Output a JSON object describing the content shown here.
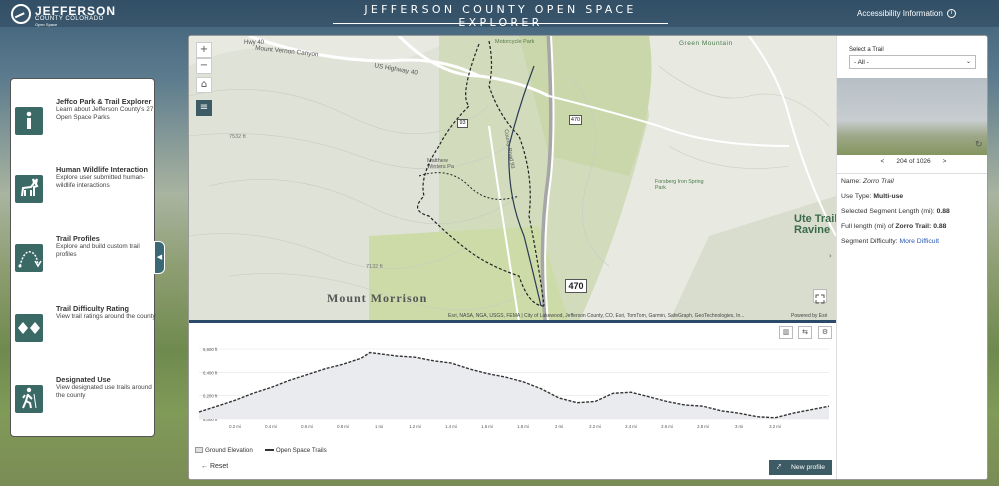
{
  "header": {
    "logo_line1": "JEFFERSON",
    "logo_line2": "COUNTY COLORADO",
    "logo_line3": "Open Space",
    "title": "JEFFERSON COUNTY OPEN SPACE EXPLORER",
    "accessibility": "Accessibility Information",
    "help_icon": "question-circle-icon"
  },
  "sidebar": {
    "items": [
      {
        "title": "Jeffco Park & Trail Explorer",
        "desc": "Learn about Jefferson County's 27 Open Space Parks",
        "icon": "info-icon"
      },
      {
        "title": "Human Wildlife Interaction",
        "desc": "Explore user submitted human-wildlife interactions",
        "icon": "deer-icon"
      },
      {
        "title": "Trail Profiles",
        "desc": "Explore and build custom trail profiles",
        "icon": "trail-profile-icon"
      },
      {
        "title": "Trail Difficulty Rating",
        "desc": "View trail ratings around the county",
        "icon": "diamond-icon"
      },
      {
        "title": "Designated Use",
        "desc": "View designated use trails around the county",
        "icon": "hiker-icon"
      }
    ]
  },
  "map": {
    "labels": {
      "mount_vernon": "Mount Vernon Canyon",
      "us_highway": "US Highway 40",
      "hwy_40": "Hwy 40",
      "motorcycle": "Motorcycle Park",
      "green_mountain": "Green Mountain",
      "county_road": "County Road 93",
      "matthews": "Matthew Winters Pa",
      "forsberg": "Forsberg Iron Spring Park",
      "ute_trail": "Ute Trail Ravine",
      "mount_morrison": "Mount Morrison",
      "elev1": "7532 ft",
      "elev2": "7132 ft",
      "shield_93": "93",
      "shield_470": "470",
      "shield_470b": "470"
    },
    "attribution": "Esri, NASA, NGA, USGS, FEMA | City of Lakewood, Jefferson County, CO, Esri, TomTom, Garmin, SafeGraph, GeoTechnologies, In...",
    "powered": "Powered by Esri"
  },
  "trail_panel": {
    "select_label": "Select a Trail",
    "select_value": "- All -",
    "pager_text": "204 of 1026",
    "prev": "<",
    "next": ">",
    "name_label": "Name:",
    "name_value": "Zorro Trail",
    "use_label": "Use Type:",
    "use_value": "Multi-use",
    "seg_label": "Selected Segment Length (mi):",
    "seg_value": "0.88",
    "full_label": "Full length (mi) of",
    "full_trail": "Zorro Trail:",
    "full_value": "0.88",
    "diff_label": "Segment Difficulty:",
    "diff_value": "More Difficult"
  },
  "profile": {
    "legend_ground": "Ground Elevation",
    "legend_trails": "Open Space Trails",
    "reset": "Reset",
    "new_profile": "New profile"
  },
  "colors": {
    "accent": "#3d5b64",
    "sidebar_icon": "#3b6a66",
    "link": "#2a5bb5"
  },
  "chart_data": {
    "type": "area",
    "xlabel": "",
    "ylabel": "",
    "x_ticks": [
      "0.2 mi",
      "0.4 mi",
      "0.6 mi",
      "0.8 mi",
      "1 mi",
      "1.2 mi",
      "1.4 mi",
      "1.6 mi",
      "1.8 mi",
      "2 mi",
      "2.2 mi",
      "2.4 mi",
      "2.6 mi",
      "2.8 mi",
      "3 mi",
      "3.2 mi"
    ],
    "y_ticks": [
      "6,600 ft",
      "6,400 ft",
      "6,200 ft",
      "6,000 ft"
    ],
    "xlim": [
      0,
      3.5
    ],
    "ylim": [
      6000,
      6600
    ],
    "series": [
      {
        "name": "Ground Elevation",
        "x": [
          0,
          0.1,
          0.2,
          0.3,
          0.4,
          0.5,
          0.6,
          0.7,
          0.8,
          0.9,
          0.95,
          1.0,
          1.1,
          1.2,
          1.3,
          1.4,
          1.5,
          1.6,
          1.7,
          1.8,
          1.9,
          2.0,
          2.1,
          2.2,
          2.3,
          2.4,
          2.5,
          2.6,
          2.7,
          2.8,
          2.9,
          3.0,
          3.1,
          3.2,
          3.3,
          3.4,
          3.5
        ],
        "y": [
          6060,
          6110,
          6160,
          6220,
          6270,
          6330,
          6380,
          6430,
          6470,
          6520,
          6570,
          6560,
          6540,
          6530,
          6500,
          6480,
          6430,
          6390,
          6360,
          6320,
          6260,
          6180,
          6140,
          6150,
          6220,
          6230,
          6190,
          6150,
          6120,
          6110,
          6070,
          6050,
          6020,
          6010,
          6050,
          6080,
          6110
        ]
      }
    ]
  }
}
